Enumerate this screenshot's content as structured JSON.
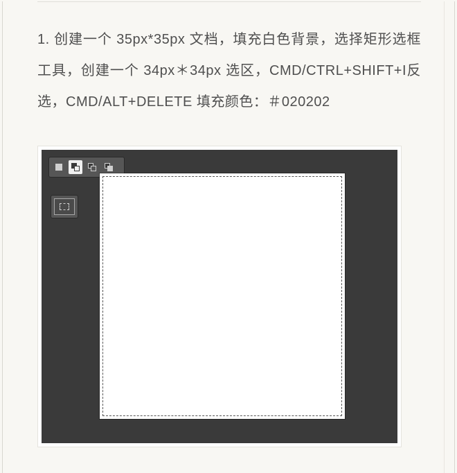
{
  "step": {
    "number": "1.",
    "text": "创建一个 35px*35px 文档，填充白色背景，选择矩形选框工具，创建一个 34px＊34px 选区，CMD/CTRL+SHIFT+I反选，CMD/ALT+DELETE 填充颜色：＃020202"
  },
  "figure": {
    "toolbar_icons": [
      "normal",
      "add",
      "subtract",
      "intersect"
    ],
    "tool": "rectangular-marquee",
    "doc_size_px": 35,
    "selection_size_px": 34,
    "fill_color": "#020202"
  }
}
